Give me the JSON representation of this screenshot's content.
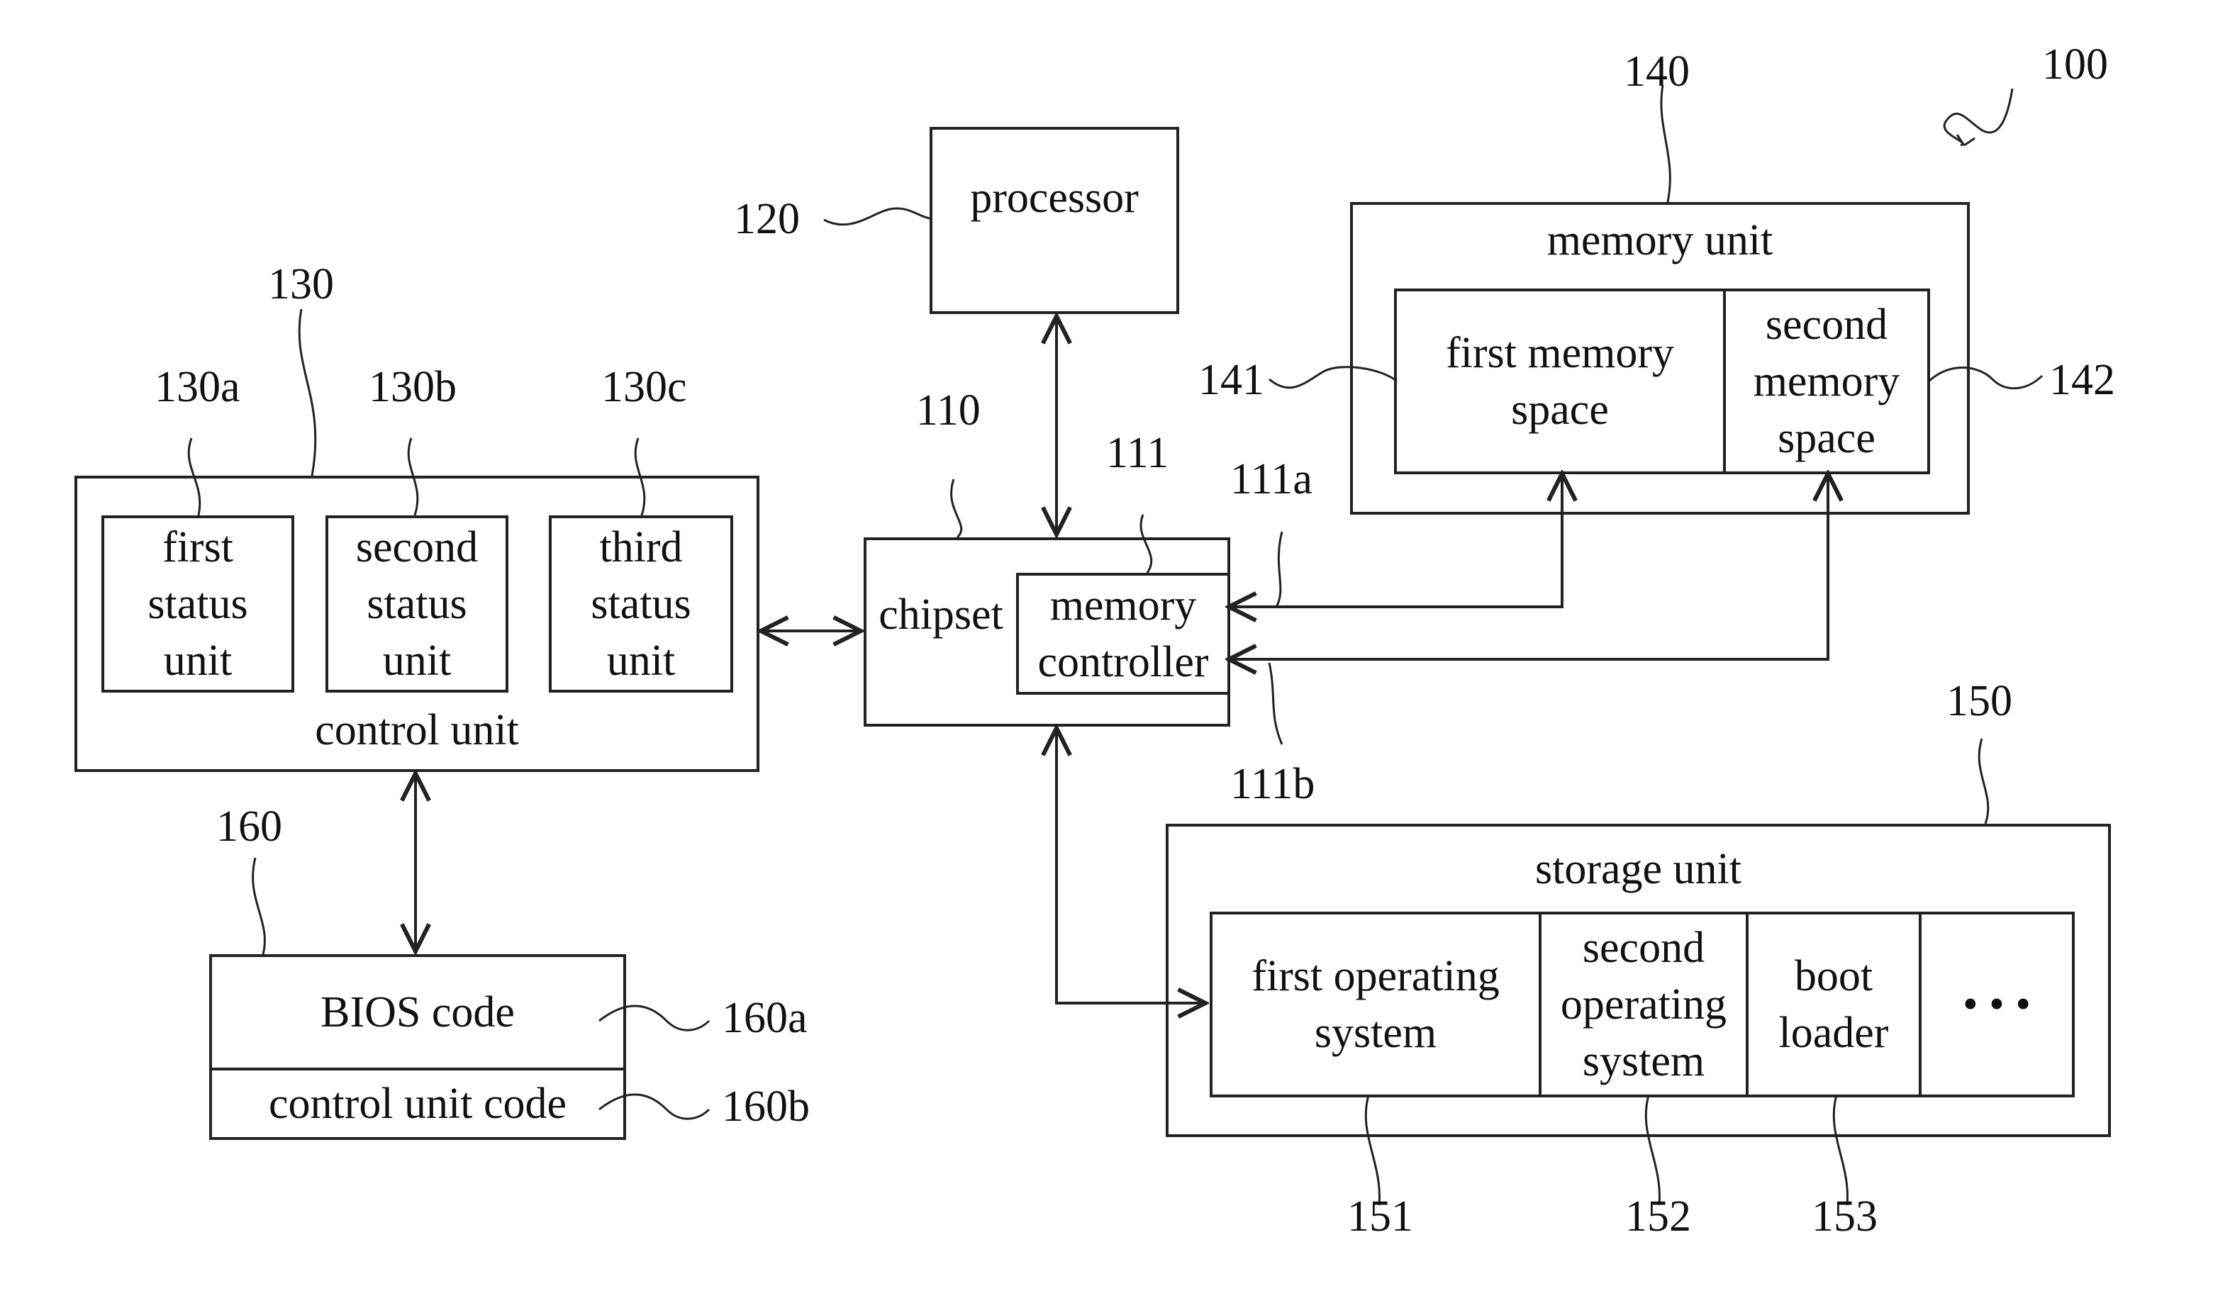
{
  "figure": {
    "system_ref": "100",
    "components": {
      "chipset": {
        "ref": "110",
        "label": "chipset"
      },
      "memory_controller": {
        "ref": "111",
        "label_line1": "memory",
        "label_line2": "controller",
        "port_a_ref": "111a",
        "port_b_ref": "111b"
      },
      "processor": {
        "ref": "120",
        "label": "processor"
      },
      "control_unit": {
        "ref": "130",
        "label": "control unit",
        "status_units": [
          {
            "ref": "130a",
            "line1": "first",
            "line2": "status",
            "line3": "unit"
          },
          {
            "ref": "130b",
            "line1": "second",
            "line2": "status",
            "line3": "unit"
          },
          {
            "ref": "130c",
            "line1": "third",
            "line2": "status",
            "line3": "unit"
          }
        ]
      },
      "memory_unit": {
        "ref": "140",
        "label": "memory unit",
        "spaces": [
          {
            "ref": "141",
            "line1": "first memory",
            "line2": "space"
          },
          {
            "ref": "142",
            "line1": "second",
            "line2": "memory",
            "line3": "space"
          }
        ]
      },
      "storage_unit": {
        "ref": "150",
        "label": "storage unit",
        "items": [
          {
            "ref": "151",
            "line1": "first operating",
            "line2": "system"
          },
          {
            "ref": "152",
            "line1": "second",
            "line2": "operating",
            "line3": "system"
          },
          {
            "ref": "153",
            "line1": "boot",
            "line2": "loader"
          },
          {
            "ref": "",
            "line1": "• • •"
          }
        ]
      },
      "bios_chip": {
        "ref": "160",
        "sections": [
          {
            "ref": "160a",
            "label": "BIOS code"
          },
          {
            "ref": "160b",
            "label": "control unit code"
          }
        ]
      }
    }
  }
}
